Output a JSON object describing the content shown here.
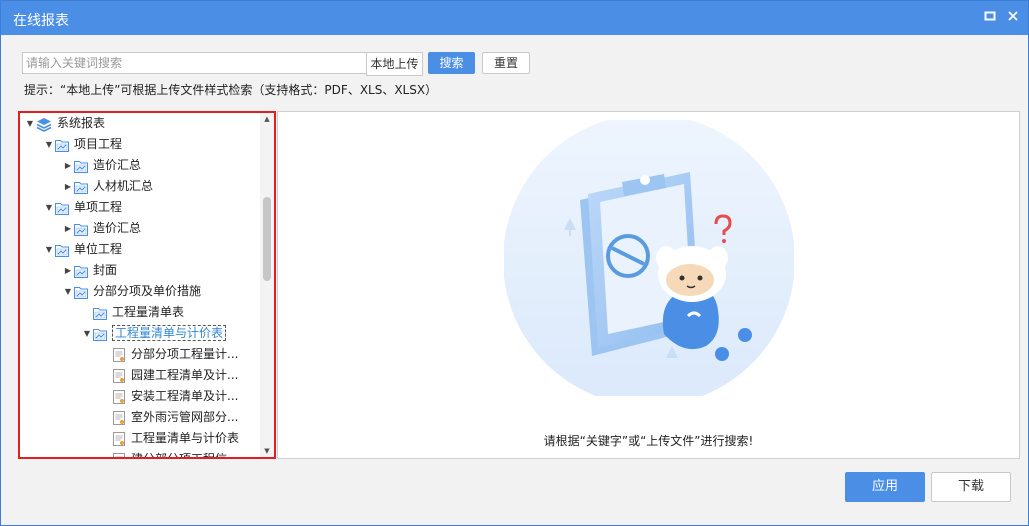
{
  "window": {
    "title": "在线报表",
    "maximize_icon": "maximize-icon",
    "close_icon": "close-icon"
  },
  "search": {
    "placeholder": "请输入关键词搜索",
    "value": "",
    "upload_label": "本地上传",
    "search_label": "搜索",
    "reset_label": "重置",
    "hint": "提示：“本地上传”可根据上传文件样式检索（支持格式：PDF、XLS、XLSX）"
  },
  "tree": {
    "items": [
      {
        "label": "系统报表",
        "level": 0,
        "arrow": "down",
        "icon": "layers-icon"
      },
      {
        "label": "项目工程",
        "level": 1,
        "arrow": "down",
        "icon": "report-folder-icon"
      },
      {
        "label": "造价汇总",
        "level": 2,
        "arrow": "right",
        "icon": "report-folder-icon"
      },
      {
        "label": "人材机汇总",
        "level": 2,
        "arrow": "right",
        "icon": "report-folder-icon"
      },
      {
        "label": "单项工程",
        "level": 1,
        "arrow": "down",
        "icon": "report-folder-icon"
      },
      {
        "label": "造价汇总",
        "level": 2,
        "arrow": "right",
        "icon": "report-folder-icon"
      },
      {
        "label": "单位工程",
        "level": 1,
        "arrow": "down",
        "icon": "report-folder-icon"
      },
      {
        "label": "封面",
        "level": 2,
        "arrow": "right",
        "icon": "report-folder-icon"
      },
      {
        "label": "分部分项及单价措施",
        "level": 2,
        "arrow": "down",
        "icon": "report-folder-icon"
      },
      {
        "label": "工程量清单表",
        "level": 3,
        "arrow": "none",
        "icon": "report-folder-icon"
      },
      {
        "label": "工程量清单与计价表",
        "level": 3,
        "arrow": "down",
        "icon": "report-folder-icon",
        "selected": true
      },
      {
        "label": "分部分项工程量计...",
        "level": 4,
        "arrow": "none",
        "icon": "report-file-icon"
      },
      {
        "label": "园建工程清单及计...",
        "level": 4,
        "arrow": "none",
        "icon": "report-file-icon"
      },
      {
        "label": "安装工程清单及计...",
        "level": 4,
        "arrow": "none",
        "icon": "report-file-icon"
      },
      {
        "label": "室外雨污管网部分...",
        "level": 4,
        "arrow": "none",
        "icon": "report-file-icon"
      },
      {
        "label": "工程量清单与计价表",
        "level": 4,
        "arrow": "none",
        "icon": "report-file-icon"
      },
      {
        "label": "建分部分项工程信...",
        "level": 4,
        "arrow": "none",
        "icon": "report-file-icon"
      }
    ]
  },
  "main": {
    "illustration_icon": "search-empty-mascot-icon",
    "empty_message": "请根据“关键字”或“上传文件”进行搜索!"
  },
  "footer": {
    "apply_label": "应用",
    "download_label": "下载"
  },
  "colors": {
    "accent": "#4a8ee6",
    "highlight_border": "#e02020",
    "selected_text": "#2f86d8"
  }
}
